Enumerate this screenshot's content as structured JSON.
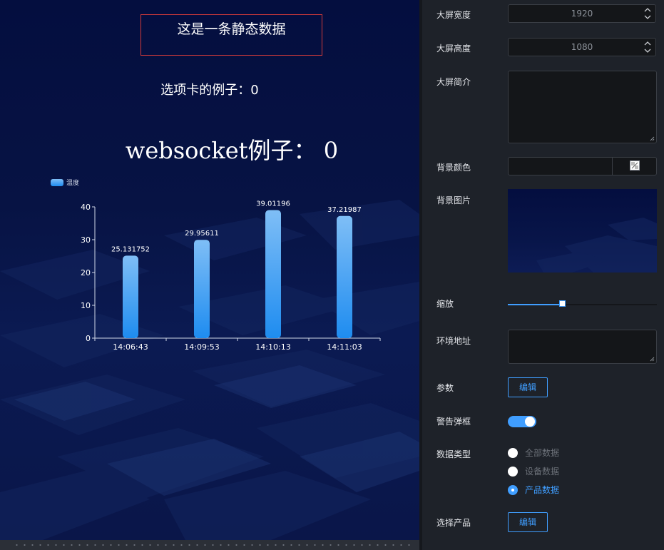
{
  "canvas": {
    "static_text": "这是一条静态数据",
    "tab_text": "选项卡的例子：0",
    "websocket_text": "websocket例子：  0"
  },
  "chart_data": {
    "type": "bar",
    "legend": [
      "温度"
    ],
    "legend_position": "top-left",
    "categories": [
      "14:06:43",
      "14:09:53",
      "14:10:13",
      "14:11:03"
    ],
    "series": [
      {
        "name": "温度",
        "values": [
          25.131752,
          29.95611,
          39.01196,
          37.21987
        ]
      }
    ],
    "data_labels": [
      "25.131752",
      "29.95611",
      "39.01196",
      "37.21987"
    ],
    "y_ticks": [
      0,
      10,
      20,
      30,
      40
    ],
    "ylim": [
      0,
      40
    ],
    "grid": false,
    "colors": {
      "bar_top": "#7fbef6",
      "bar_bottom": "#1e8cf0",
      "axis": "#cfd6e6",
      "text": "#ffffff"
    }
  },
  "panel": {
    "width_label": "大屏宽度",
    "width_value": "1920",
    "height_label": "大屏高度",
    "height_value": "1080",
    "intro_label": "大屏简介",
    "intro_value": "",
    "bg_color_label": "背景颜色",
    "bg_image_label": "背景图片",
    "zoom_label": "缩放",
    "zoom_level": 0.37,
    "env_label": "环境地址",
    "env_value": "",
    "params_label": "参数",
    "params_button": "编辑",
    "alert_label": "警告弹框",
    "alert_on": true,
    "data_type_label": "数据类型",
    "data_type_options": [
      {
        "label": "全部数据",
        "checked": false
      },
      {
        "label": "设备数据",
        "checked": false
      },
      {
        "label": "产品数据",
        "checked": true
      }
    ],
    "product_label": "选择产品",
    "product_button": "编辑"
  },
  "colors": {
    "accent": "#409eff",
    "panel_bg": "#1e2229",
    "input_bg": "#141619",
    "canvas_bg": "#071344",
    "static_border": "#d03a3a"
  }
}
